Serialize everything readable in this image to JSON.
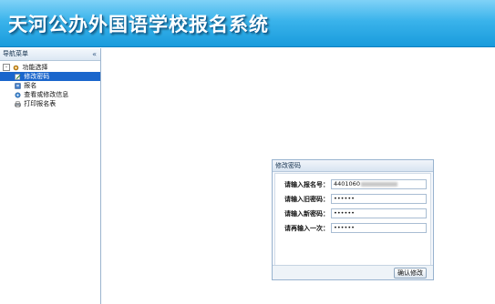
{
  "header": {
    "title": "天河公办外国语学校报名系统"
  },
  "sidebar": {
    "title": "导航菜单",
    "collapse_label": "«",
    "root": {
      "toggle": "-",
      "label": "功能选择",
      "icon": "gear-icon"
    },
    "items": [
      {
        "label": "修改密码",
        "icon": "edit-icon",
        "selected": true
      },
      {
        "label": "报名",
        "icon": "form-icon"
      },
      {
        "label": "查看或修改信息",
        "icon": "settings-icon"
      },
      {
        "label": "打印报名表",
        "icon": "printer-icon"
      }
    ]
  },
  "dialog": {
    "title": "修改密码",
    "fields": [
      {
        "label": "请输入报名号：",
        "value": "4401060"
      },
      {
        "label": "请输入旧密码：",
        "value": "••••••"
      },
      {
        "label": "请输入新密码：",
        "value": "••••••"
      },
      {
        "label": "请再输入一次：",
        "value": "••••••"
      }
    ],
    "submit_label": "确认修改"
  }
}
